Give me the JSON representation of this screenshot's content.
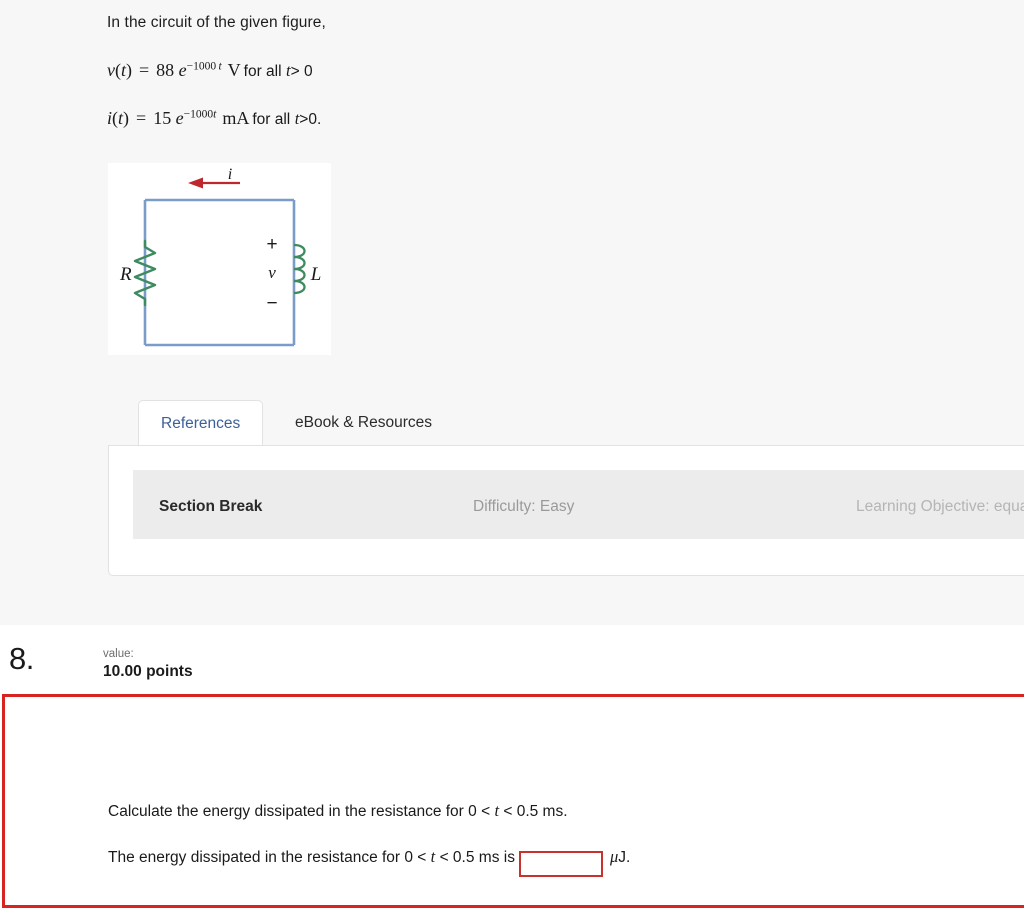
{
  "top_section": {
    "stem": "In the circuit of the given figure,",
    "equations": [
      {
        "id": "voltage",
        "lhs_var": "v",
        "lhs_arg": "t",
        "equals": "=",
        "coefficient": "88",
        "base": "e",
        "exponent": "−1000",
        "exponent_var": "t",
        "unit": "V",
        "condition": "for all",
        "condition_var": "t",
        "condition_rest": "> 0"
      },
      {
        "id": "current",
        "lhs_var": "i",
        "lhs_arg": "t",
        "equals": "=",
        "coefficient": "15",
        "base": "e",
        "exponent": "−1000",
        "exponent_var": "t",
        "unit": "mA",
        "condition": "for all",
        "condition_var": "t",
        "condition_rest": ">0."
      }
    ],
    "figure": {
      "current_label": "i",
      "resistor_label": "R",
      "inductor_label": "L",
      "voltage_label": "v",
      "plus_label": "+",
      "minus_label": "−",
      "wire_color": "#7b9bc8",
      "component_color": "#3d8b5e",
      "arrow_color": "#c0272d",
      "background": "#ffffff"
    }
  },
  "tabs": {
    "items": [
      {
        "label": "References",
        "active": true
      },
      {
        "label": "eBook & Resources",
        "active": false
      }
    ],
    "active_color": "#3c6099",
    "panel": {
      "section_break": "Section Break",
      "difficulty": "Difficulty: Easy",
      "learning_objective": "Learning Objective: equations."
    }
  },
  "question": {
    "number": "8.",
    "value_label": "value:",
    "points": "10.00 points",
    "prompt_before_var": "Calculate the energy dissipated in the resistance for 0 < ",
    "prompt_var": "t",
    "prompt_after_var": " < 0.5 ms.",
    "answer_before_var": "The energy dissipated in the resistance for 0 < ",
    "answer_var": "t",
    "answer_after_var": " < 0.5 ms is",
    "input_value": "",
    "input_placeholder": "",
    "unit_mu": "μ",
    "unit_j": "J.",
    "border_color": "#d8241f",
    "input_border_color": "#c8322c"
  }
}
